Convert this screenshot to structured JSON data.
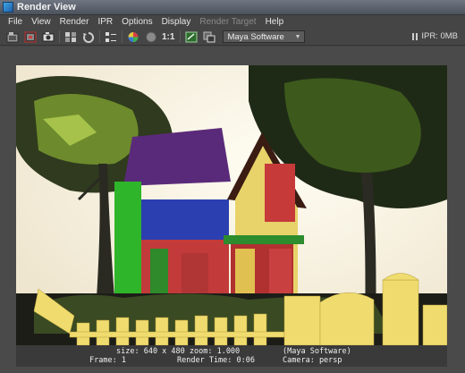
{
  "window": {
    "title": "Render View"
  },
  "menu": {
    "items": [
      {
        "label": "File",
        "enabled": true
      },
      {
        "label": "View",
        "enabled": true
      },
      {
        "label": "Render",
        "enabled": true
      },
      {
        "label": "IPR",
        "enabled": true
      },
      {
        "label": "Options",
        "enabled": true
      },
      {
        "label": "Display",
        "enabled": true
      },
      {
        "label": "Render Target",
        "enabled": false
      },
      {
        "label": "Help",
        "enabled": true
      }
    ]
  },
  "toolbar": {
    "ratio_label": "1:1",
    "renderer": "Maya Software",
    "ipr_status": "IPR: 0MB"
  },
  "render": {
    "size_text": "size: 640 x 480 zoom: 1.000",
    "renderer_text": "(Maya Software)",
    "frame_text": "Frame: 1",
    "render_time_text": "Render Time: 0:06",
    "camera_text": "Camera: persp"
  }
}
